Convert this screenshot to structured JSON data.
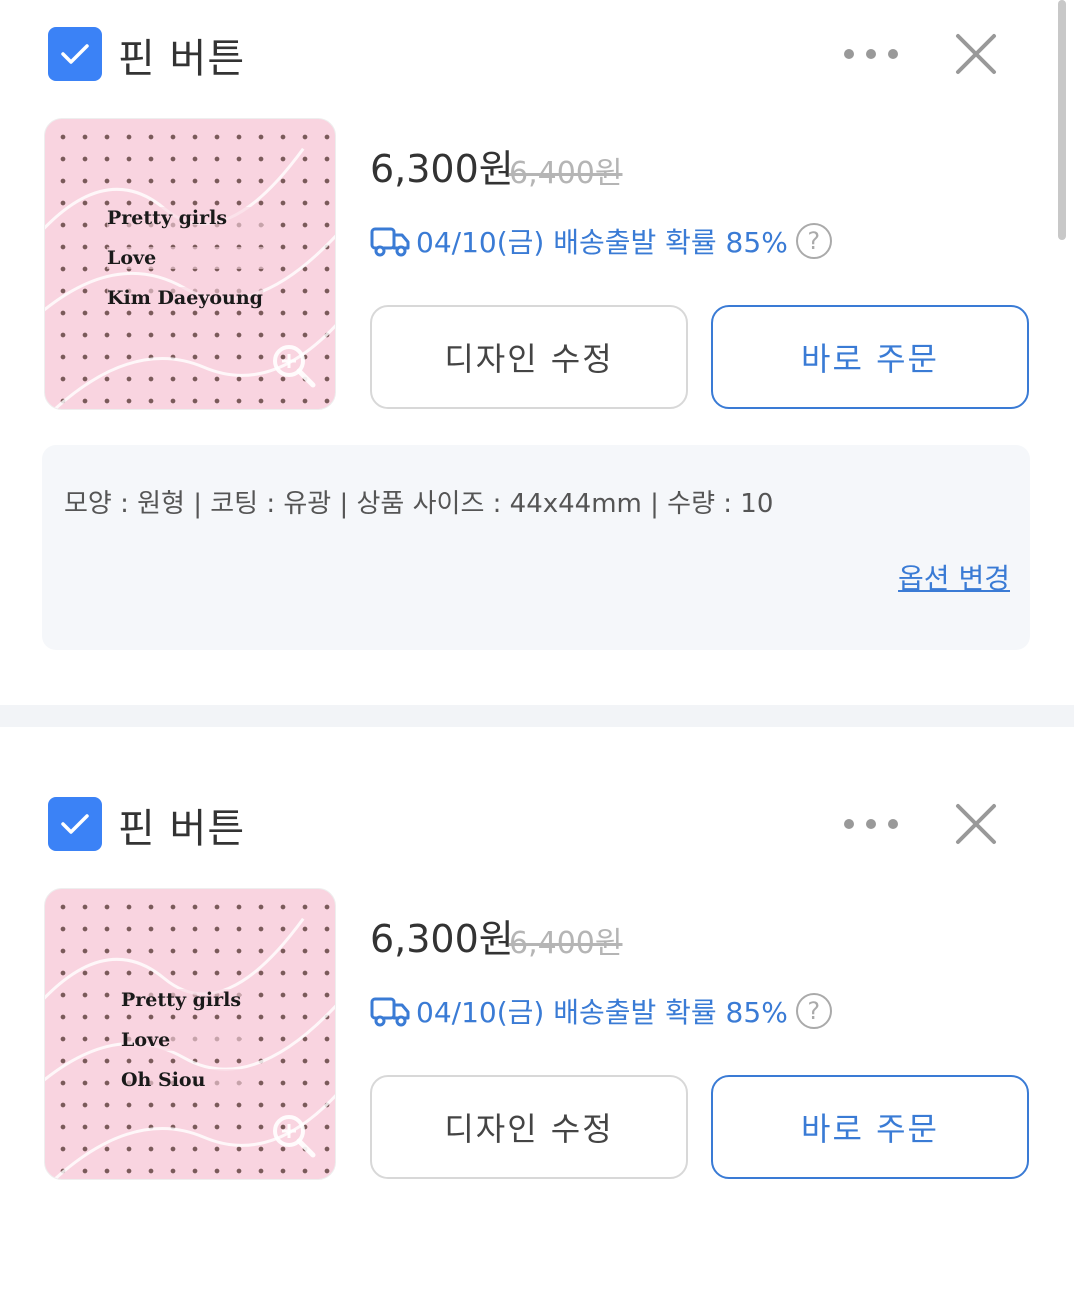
{
  "items": [
    {
      "checked": true,
      "name": "핀 버튼",
      "price": "6,300원",
      "original_price": "6,400원",
      "delivery_text": "04/10(금) 배송출발 확률 85%",
      "help_label": "?",
      "thumbnail_lines": [
        "Pretty girls",
        "Love",
        "Kim Daeyoung"
      ],
      "edit_label": "디자인 수정",
      "order_label": "바로 주문",
      "options_text": "모양 : 원형 | 코팅 : 유광 | 상품 사이즈 : 44x44mm | 수량 : 10",
      "option_change_label": "옵션 변경"
    },
    {
      "checked": true,
      "name": "핀 버튼",
      "price": "6,300원",
      "original_price": "6,400원",
      "delivery_text": "04/10(금) 배송출발 확률 85%",
      "help_label": "?",
      "thumbnail_lines": [
        "Pretty girls",
        "Love",
        "Oh Siou"
      ],
      "edit_label": "디자인 수정",
      "order_label": "바로 주문"
    }
  ],
  "icons": {
    "checkbox": "checkmark-icon",
    "more": "more-dots-icon",
    "close": "close-icon",
    "delivery": "truck-icon",
    "zoom": "zoom-icon"
  },
  "colors": {
    "accent": "#3b82f6",
    "link": "#3a7bd5",
    "thumbnail_bg": "#f9d4e0"
  }
}
